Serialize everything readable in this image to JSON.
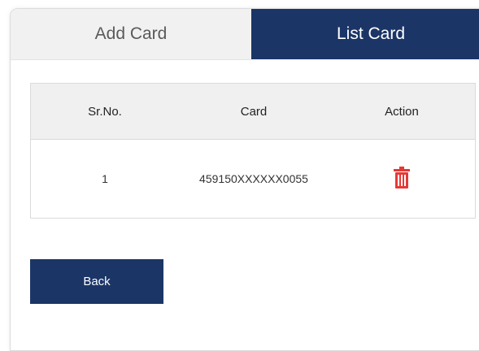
{
  "tabs": {
    "add_card": "Add Card",
    "list_card": "List Card"
  },
  "table": {
    "headers": [
      "Sr.No.",
      "Card",
      "Action"
    ],
    "rows": [
      {
        "sr_no": "1",
        "card": "459150XXXXXX0055",
        "action_icon": "trash-icon"
      }
    ]
  },
  "buttons": {
    "back": "Back"
  },
  "colors": {
    "primary": "#1b3566",
    "delete": "#e53935",
    "header_bg": "#f0f0f0",
    "inactive_tab_bg": "#f1f1f1"
  }
}
